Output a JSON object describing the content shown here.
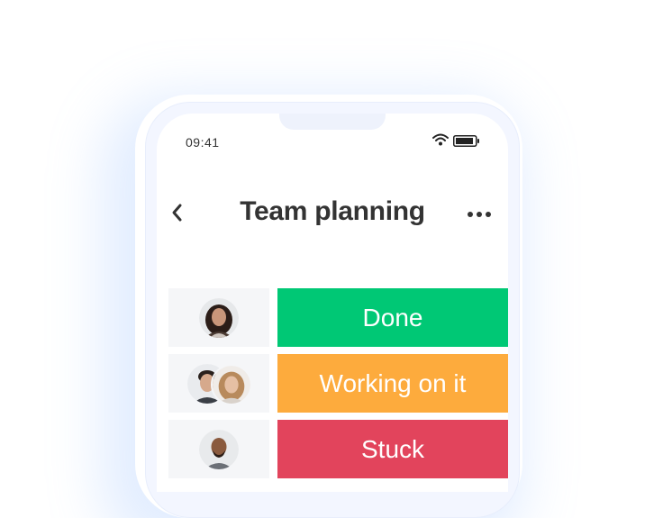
{
  "status_bar": {
    "time": "09:41",
    "icons": [
      "wifi-icon",
      "battery-icon"
    ]
  },
  "header": {
    "back_icon": "chevron-left-icon",
    "title": "Team planning",
    "more_icon": "more-horizontal-icon"
  },
  "rows": [
    {
      "status": "Done",
      "color": "#00c875",
      "avatars": [
        "avatar-woman-curly-hair"
      ]
    },
    {
      "status": "Working on it",
      "color": "#fdab3d",
      "avatars": [
        "avatar-man",
        "avatar-woman-smiling"
      ]
    },
    {
      "status": "Stuck",
      "color": "#e2445c",
      "avatars": [
        "avatar-man-bald"
      ]
    }
  ]
}
